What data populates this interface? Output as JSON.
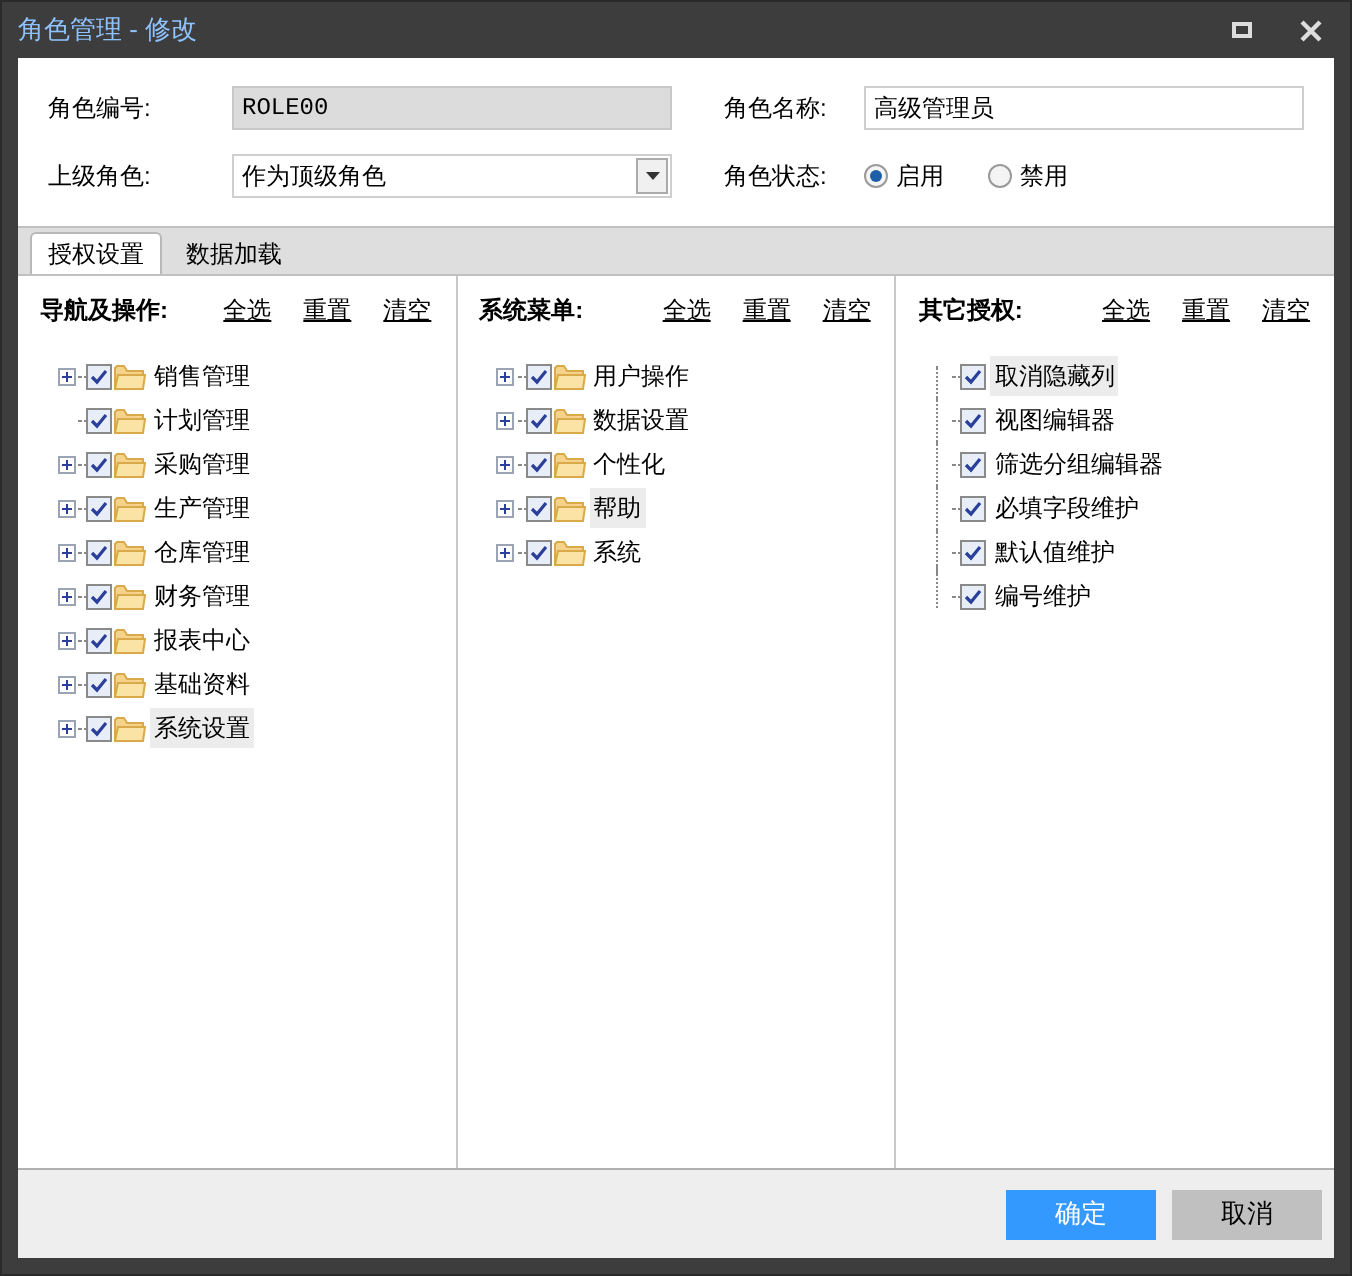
{
  "window": {
    "title": "角色管理 - 修改"
  },
  "form": {
    "code_label": "角色编号:",
    "code_value": "ROLE00",
    "name_label": "角色名称:",
    "name_value": "高级管理员",
    "parent_label": "上级角色:",
    "parent_value": "作为顶级角色",
    "status_label": "角色状态:",
    "status_options": [
      {
        "label": "启用",
        "selected": true
      },
      {
        "label": "禁用",
        "selected": false
      }
    ]
  },
  "tabs": [
    {
      "label": "授权设置",
      "selected": true
    },
    {
      "label": "数据加载",
      "selected": false
    }
  ],
  "panels": [
    {
      "title": "导航及操作:",
      "kind": "folder-tree",
      "actions": [
        "全选",
        "重置",
        "清空"
      ],
      "items": [
        {
          "label": "销售管理",
          "expandable": true,
          "checked": true,
          "selected": false
        },
        {
          "label": "计划管理",
          "expandable": false,
          "checked": true,
          "selected": false
        },
        {
          "label": "采购管理",
          "expandable": true,
          "checked": true,
          "selected": false
        },
        {
          "label": "生产管理",
          "expandable": true,
          "checked": true,
          "selected": false
        },
        {
          "label": "仓库管理",
          "expandable": true,
          "checked": true,
          "selected": false
        },
        {
          "label": "财务管理",
          "expandable": true,
          "checked": true,
          "selected": false
        },
        {
          "label": "报表中心",
          "expandable": true,
          "checked": true,
          "selected": false
        },
        {
          "label": "基础资料",
          "expandable": true,
          "checked": true,
          "selected": false
        },
        {
          "label": "系统设置",
          "expandable": true,
          "checked": true,
          "selected": true
        }
      ]
    },
    {
      "title": "系统菜单:",
      "kind": "folder-tree",
      "actions": [
        "全选",
        "重置",
        "清空"
      ],
      "items": [
        {
          "label": "用户操作",
          "expandable": true,
          "checked": true,
          "selected": false
        },
        {
          "label": "数据设置",
          "expandable": true,
          "checked": true,
          "selected": false
        },
        {
          "label": "个性化",
          "expandable": true,
          "checked": true,
          "selected": false
        },
        {
          "label": "帮助",
          "expandable": true,
          "checked": true,
          "selected": true
        },
        {
          "label": "系统",
          "expandable": true,
          "checked": true,
          "selected": false
        }
      ]
    },
    {
      "title": "其它授权:",
      "kind": "leaf-list",
      "actions": [
        "全选",
        "重置",
        "清空"
      ],
      "items": [
        {
          "label": "取消隐藏列",
          "checked": true,
          "selected": true
        },
        {
          "label": "视图编辑器",
          "checked": true,
          "selected": false
        },
        {
          "label": "筛选分组编辑器",
          "checked": true,
          "selected": false
        },
        {
          "label": "必填字段维护",
          "checked": true,
          "selected": false
        },
        {
          "label": "默认值维护",
          "checked": true,
          "selected": false
        },
        {
          "label": "编号维护",
          "checked": true,
          "selected": false
        }
      ]
    }
  ],
  "buttons": [
    {
      "label": "确定",
      "kind": "primary"
    },
    {
      "label": "取消",
      "kind": "secondary"
    }
  ]
}
